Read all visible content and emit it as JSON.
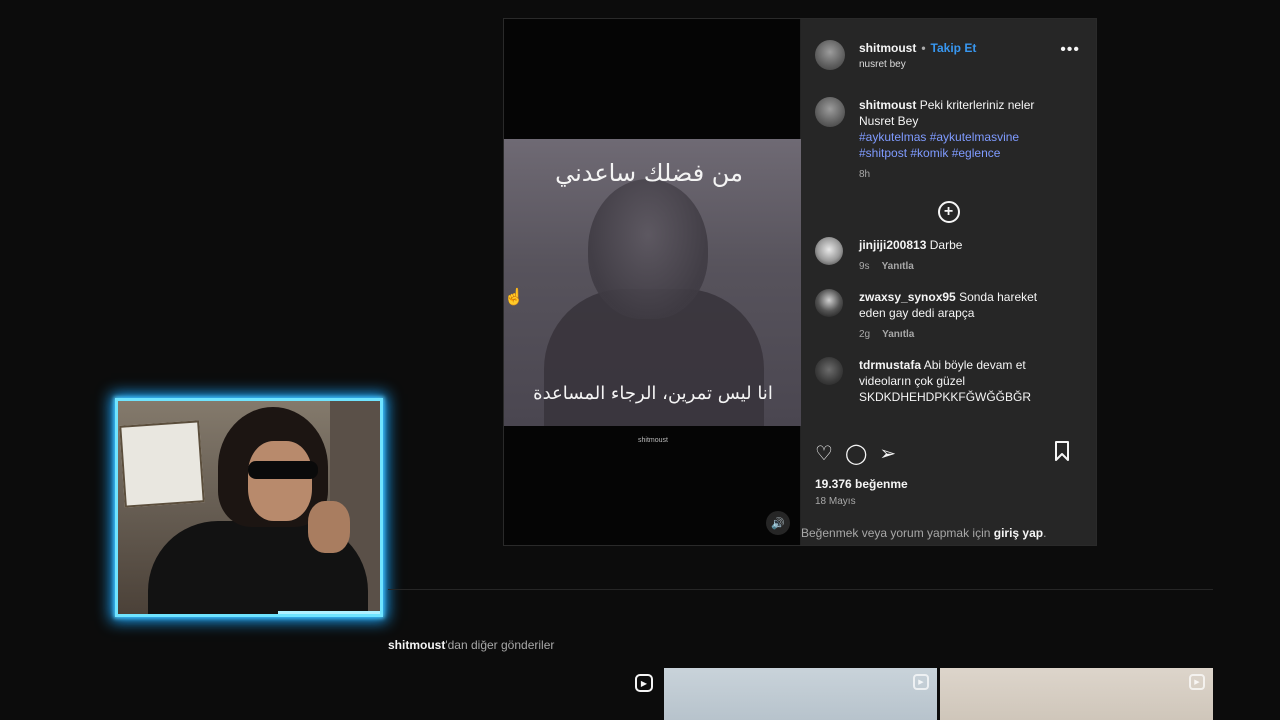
{
  "post": {
    "author": "shitmoust",
    "separator": "•",
    "follow_label": "Takip Et",
    "audio_label": "nusret bey",
    "more_label": "•••",
    "video": {
      "overlay_top": "من فضلك ساعدني",
      "overlay_bottom": "انا ليس تمرين، الرجاء المساعدة",
      "watermark": "shitmoust",
      "mute_icon": "🔊"
    },
    "caption": {
      "username": "shitmoust",
      "text": "Peki kriterleriniz neler Nusret Bey",
      "hashtags": "#aykutelmas #aykutelmasvine #shitpost #komik #eglence",
      "time": "8h"
    },
    "load_more_icon": "+",
    "comments": [
      {
        "username": "jinjiji200813",
        "text": "Darbe",
        "time": "9s",
        "reply": "Yanıtla"
      },
      {
        "username": "zwaxsy_synox95",
        "text": "Sonda hareket eden gay dedi arapça",
        "time": "2g",
        "reply": "Yanıtla"
      },
      {
        "username": "tdrmustafa",
        "text": "Abi böyle devam et videoların çok güzel SKDKDHEHDPKKFĞWĞĞBĞR",
        "time": "",
        "reply": ""
      }
    ],
    "likes": "19.376 beğenme",
    "date": "18 Mayıs",
    "login_prefix": "Beğenmek veya yorum yapmak için ",
    "login_link": "giriş yap",
    "login_suffix": "."
  },
  "more_posts": {
    "owner": "shitmoust",
    "suffix": "'dan diğer gönderiler"
  },
  "icons": {
    "like": "♡",
    "comment": "◯",
    "share": "➢",
    "save": "🔖",
    "reel": "▶"
  },
  "colors": {
    "accent_blue": "#3897f0",
    "hashtag": "#7f9bff",
    "webcam_glow": "#1aa7ff",
    "panel_bg": "#262626"
  }
}
